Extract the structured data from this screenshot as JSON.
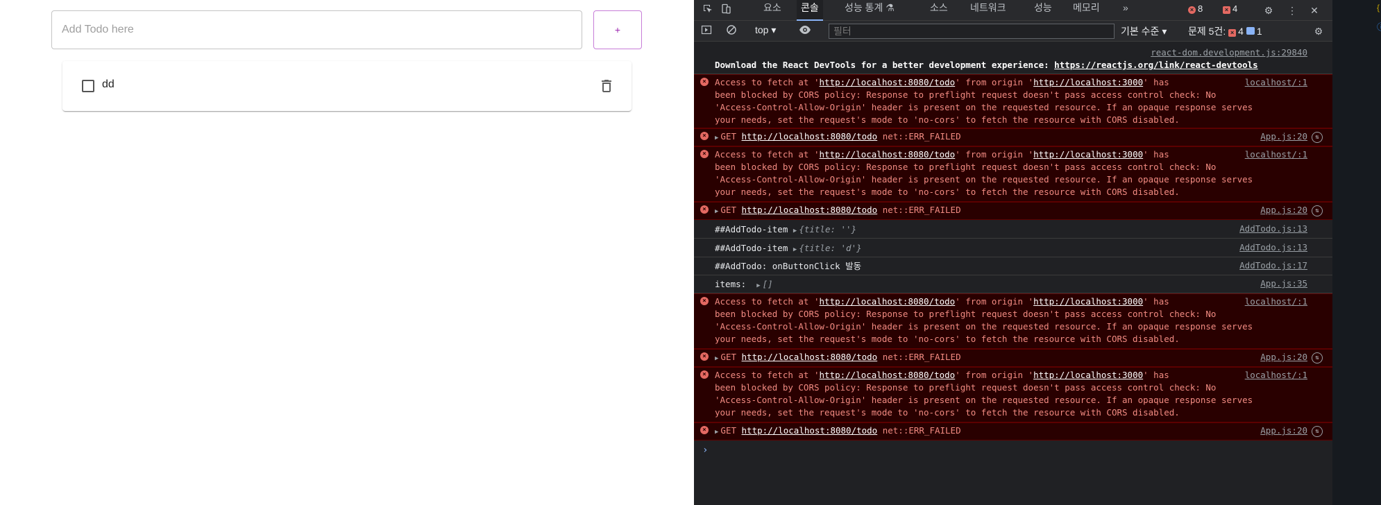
{
  "app": {
    "input_placeholder": "Add Todo here",
    "add_button": "+",
    "todos": [
      {
        "title": "dd",
        "checked": false
      }
    ]
  },
  "devtools": {
    "tabs": [
      "요소",
      "콘솔",
      "성능 통계",
      "소스",
      "네트워크",
      "성능",
      "메모리"
    ],
    "active_tab": "콘솔",
    "more": "»",
    "error_count": "8",
    "issue_count": "4",
    "context": "top",
    "filter_placeholder": "필터",
    "level": "기본 수준",
    "issues_label": "문제 5건:",
    "issues_err": "4",
    "issues_info": "1",
    "console": {
      "devtools_src": "react-dom.development.js:29840",
      "devtools_msg": "Download the React DevTools for a better development experience: ",
      "devtools_link": "https://reactjs.org/link/react-devtools",
      "cors_p1": "Access to fetch at '",
      "cors_url": "http://localhost:8080/todo",
      "cors_p2": "' from origin '",
      "cors_origin": "http://localhost:3000",
      "cors_p3": "' has",
      "cors_line2": "been blocked by CORS policy: Response to preflight request doesn't pass access control check: No",
      "cors_line3": "'Access-Control-Allow-Origin' header is present on the requested resource. If an opaque response serves",
      "cors_line4": "your needs, set the request's mode to 'no-cors' to fetch the resource with CORS disabled.",
      "cors_src": "localhost/:1",
      "get_method": "GET ",
      "get_url": "http://localhost:8080/todo",
      "get_status": " net::ERR_FAILED",
      "get_src": "App.js:20",
      "log1_msg": "##AddTodo-item ",
      "log1_val": "{title: ''}",
      "log1_src": "AddTodo.js:13",
      "log2_msg": "##AddTodo-item ",
      "log2_val": "{title: 'd'}",
      "log2_src": "AddTodo.js:13",
      "log3_msg": "##AddTodo: onButtonClick 발동",
      "log3_src": "AddTodo.js:17",
      "log4_msg": "items:  ",
      "log4_val": "[]",
      "log4_src": "App.js:35",
      "prompt": "›"
    }
  },
  "colors": {
    "accent": "#9c27b0",
    "devtools_bg": "#202124",
    "error_bg": "#290000",
    "error_text": "#f28b82"
  }
}
